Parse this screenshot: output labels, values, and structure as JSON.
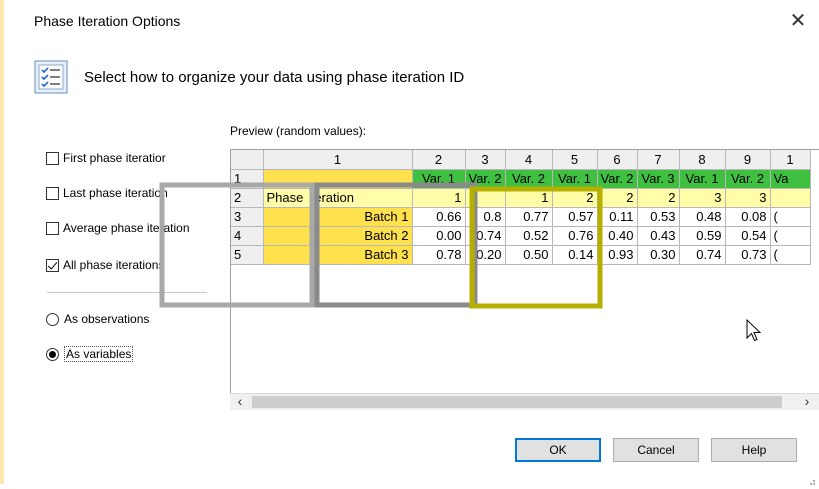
{
  "dialog": {
    "title": "Phase Iteration Options",
    "close_glyph": "✕",
    "instruction": "Select how to organize your data using phase iteration ID",
    "preview_label": "Preview (random values):"
  },
  "options": {
    "first": {
      "label": "First phase iteratior",
      "checked": false
    },
    "last": {
      "label": "Last phase iteration",
      "checked": false
    },
    "average": {
      "label": "Average phase iteration",
      "checked": false
    },
    "all": {
      "label": "All phase iterations",
      "checked": true
    }
  },
  "layout_mode": {
    "observations": {
      "label": "As observations",
      "selected": false
    },
    "variables": {
      "label": "As variables",
      "selected": true
    }
  },
  "grid": {
    "col_headers": [
      "1",
      "2",
      "3",
      "4",
      "5",
      "6",
      "7",
      "8",
      "9",
      "1"
    ],
    "row_headers": [
      "1",
      "2",
      "3",
      "4",
      "5"
    ],
    "row1": [
      "Var. 1",
      "Var. 2",
      "Var. 2",
      "Var. 1",
      "Var. 2",
      "Var. 3",
      "Var. 1",
      "Var. 2",
      "Va"
    ],
    "row2": {
      "label_a": "Phase",
      "label_b": "teration",
      "values": [
        "1",
        "",
        "1",
        "2",
        "2",
        "2",
        "3",
        "3",
        ""
      ]
    },
    "rows": [
      {
        "batch": "Batch 1",
        "values": [
          "0.66",
          "0.8",
          "0.77",
          "0.57",
          "0.11",
          "0.53",
          "0.48",
          "0.08",
          "("
        ]
      },
      {
        "batch": "Batch 2",
        "values": [
          "0.00",
          "0.74",
          "0.52",
          "0.76",
          "0.40",
          "0.43",
          "0.59",
          "0.54",
          "("
        ]
      },
      {
        "batch": "Batch 3",
        "values": [
          "0.78",
          "0.20",
          "0.50",
          "0.14",
          "0.93",
          "0.30",
          "0.74",
          "0.73",
          "("
        ]
      }
    ]
  },
  "scroll": {
    "left": "‹",
    "right": "›"
  },
  "buttons": {
    "ok": "OK",
    "cancel": "Cancel",
    "help": "Help"
  },
  "colors": {
    "highlight_light": "#a8a8a8",
    "highlight_mid": "#8a8a8a",
    "highlight_olive": "#b5b000",
    "header_green": "#40c040",
    "cell_yellow": "#fffda8",
    "id_yellow": "#ffe14d"
  }
}
